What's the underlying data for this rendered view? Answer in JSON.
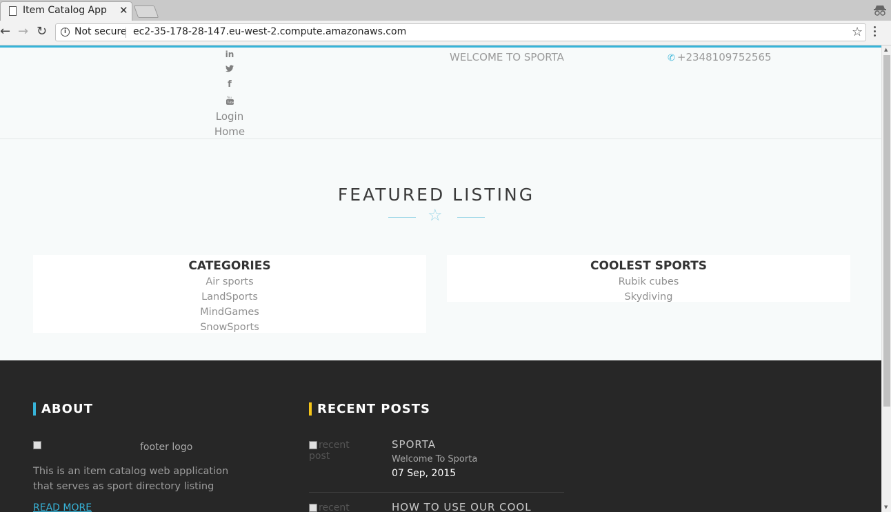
{
  "browser": {
    "tab_title": "Item Catalog App",
    "tab_close": "✕",
    "security_label": "Not secure",
    "url": "ec2-35-178-28-147.eu-west-2.compute.amazonaws.com"
  },
  "header": {
    "social_icons": [
      "linkedin-icon",
      "twitter-icon",
      "facebook-icon",
      "youtube-icon"
    ],
    "social_glyphs": [
      "in",
      "🐦",
      "f",
      "▶"
    ],
    "nav": {
      "login": "Login",
      "home": "Home"
    },
    "welcome": "WELCOME TO SPORTA",
    "phone": "+2348109752565"
  },
  "featured": {
    "title": "FEATURED LISTING"
  },
  "categories": {
    "title": "CATEGORIES",
    "items": [
      "Air sports",
      "LandSports",
      "MindGames",
      "SnowSports"
    ]
  },
  "coolest": {
    "title": "COOLEST SPORTS",
    "items": [
      "Rubik cubes",
      "Skydiving"
    ]
  },
  "footer": {
    "about": {
      "title": "ABOUT",
      "logo_alt": "footer logo",
      "text": "This is an item catalog web application that serves as sport directory listing",
      "read_more": "READ MORE"
    },
    "recent": {
      "title": "RECENT POSTS",
      "image_alt": "recent post",
      "posts": [
        {
          "title": "SPORTA",
          "subtitle": "Welcome To Sporta",
          "date": "07 Sep, 2015"
        },
        {
          "title": "HOW TO USE OUR COOL"
        }
      ]
    }
  },
  "colors": {
    "accent": "#37b4d9",
    "recent_bar": "#f5c518",
    "footer_bg": "#272727"
  }
}
